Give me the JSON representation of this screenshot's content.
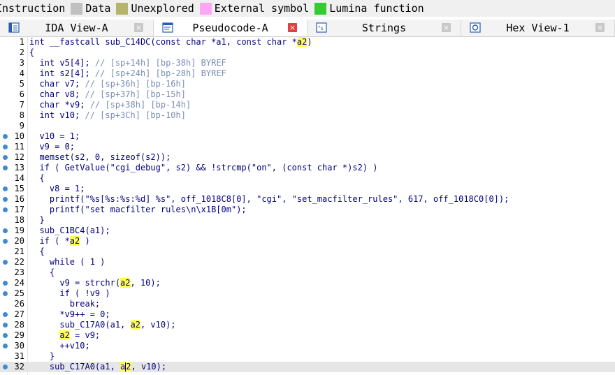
{
  "legend": [
    {
      "label": "Instruction",
      "color": "#ffffff"
    },
    {
      "label": "Data",
      "color": "#c0c0c0"
    },
    {
      "label": "Unexplored",
      "color": "#b5b56a"
    },
    {
      "label": "External symbol",
      "color": "#ffa7f3"
    },
    {
      "label": "Lumina function",
      "color": "#33cc33"
    }
  ],
  "tabs": [
    {
      "label": "IDA View-A",
      "icon": "ida-view-icon",
      "active": false
    },
    {
      "label": "Pseudocode-A",
      "icon": "pseudocode-icon",
      "active": true
    },
    {
      "label": "Strings",
      "icon": "strings-icon",
      "active": false
    },
    {
      "label": "Hex View-1",
      "icon": "hex-view-icon",
      "active": false
    }
  ],
  "close_glyph": "×",
  "code_lines": [
    {
      "n": "1",
      "bp": false,
      "html": "int __fastcall sub_C14DC(const char *a1, const char *<span class=\"hl\">a2</span>)"
    },
    {
      "n": "2",
      "bp": false,
      "html": "{"
    },
    {
      "n": "3",
      "bp": false,
      "html": "  int v5[4]; <span class=\"cmt\">// [sp+14h] [bp-38h] BYREF</span>"
    },
    {
      "n": "4",
      "bp": false,
      "html": "  int s2[4]; <span class=\"cmt\">// [sp+24h] [bp-28h] BYREF</span>"
    },
    {
      "n": "5",
      "bp": false,
      "html": "  char v7; <span class=\"cmt\">// [sp+36h] [bp-16h]</span>"
    },
    {
      "n": "6",
      "bp": false,
      "html": "  char v8; <span class=\"cmt\">// [sp+37h] [bp-15h]</span>"
    },
    {
      "n": "7",
      "bp": false,
      "html": "  char *v9; <span class=\"cmt\">// [sp+38h] [bp-14h]</span>"
    },
    {
      "n": "8",
      "bp": false,
      "html": "  int v10; <span class=\"cmt\">// [sp+3Ch] [bp-10h]</span>"
    },
    {
      "n": "9",
      "bp": false,
      "html": ""
    },
    {
      "n": "10",
      "bp": true,
      "html": "  v10 = 1;"
    },
    {
      "n": "11",
      "bp": true,
      "html": "  v9 = 0;"
    },
    {
      "n": "12",
      "bp": true,
      "html": "  memset(s2, 0, sizeof(s2));"
    },
    {
      "n": "13",
      "bp": true,
      "html": "  if ( GetValue(\"cgi_debug\", s2) &amp;&amp; !strcmp(\"on\", (const char *)s2) )"
    },
    {
      "n": "14",
      "bp": false,
      "html": "  {"
    },
    {
      "n": "15",
      "bp": true,
      "html": "    v8 = 1;"
    },
    {
      "n": "16",
      "bp": true,
      "html": "    printf(\"%s[%s:%s:%d] %s\", off_1018C8[0], \"cgi\", \"set_macfilter_rules\", 617, off_1018C0[0]);"
    },
    {
      "n": "17",
      "bp": true,
      "html": "    printf(\"set macfilter rules\\n\\x1B[0m\");"
    },
    {
      "n": "18",
      "bp": false,
      "html": "  }"
    },
    {
      "n": "19",
      "bp": true,
      "html": "  sub_C1BC4(a1);"
    },
    {
      "n": "20",
      "bp": true,
      "html": "  if ( *<span class=\"hl\">a2</span> )"
    },
    {
      "n": "21",
      "bp": false,
      "html": "  {"
    },
    {
      "n": "22",
      "bp": true,
      "html": "    while ( 1 )"
    },
    {
      "n": "23",
      "bp": false,
      "html": "    {"
    },
    {
      "n": "24",
      "bp": true,
      "html": "      v9 = strchr(<span class=\"hl\">a2</span>, 10);"
    },
    {
      "n": "25",
      "bp": true,
      "html": "      if ( !v9 )"
    },
    {
      "n": "26",
      "bp": false,
      "html": "        break;"
    },
    {
      "n": "27",
      "bp": true,
      "html": "      *v9++ = 0;"
    },
    {
      "n": "28",
      "bp": true,
      "html": "      sub_C17A0(a1, <span class=\"hl\">a2</span>, v10);"
    },
    {
      "n": "29",
      "bp": true,
      "html": "      <span class=\"hl\">a2</span> = v9;"
    },
    {
      "n": "30",
      "bp": true,
      "html": "      ++v10;"
    },
    {
      "n": "31",
      "bp": false,
      "html": "    }"
    },
    {
      "n": "32",
      "bp": true,
      "current": true,
      "html": "    sub_C17A0(a1, <span class=\"hl\">a</span><span class=\"cursor\"></span><span class=\"hl\">2</span>, v10);"
    }
  ]
}
